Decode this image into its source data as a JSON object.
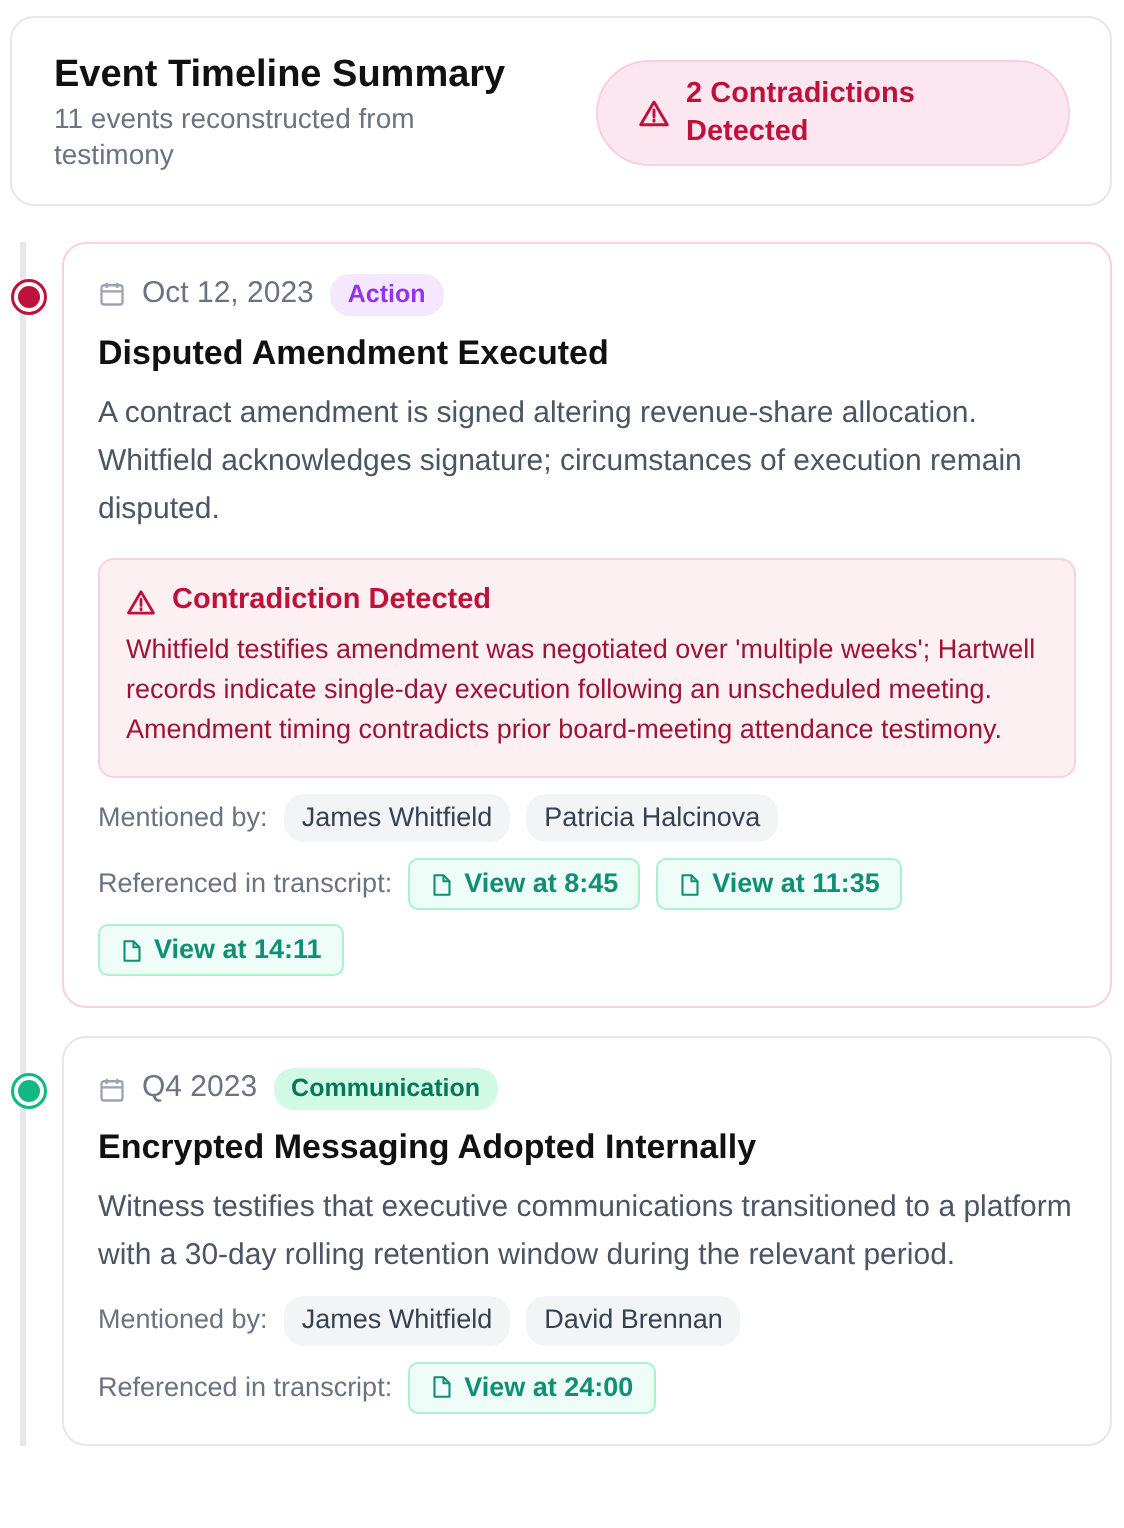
{
  "summary": {
    "title": "Event Timeline Summary",
    "subtitle": "11 events reconstructed from testimony",
    "alert": "2 Contradictions Detected"
  },
  "events": [
    {
      "color": "#be123c",
      "date": "Oct 12, 2023",
      "tag": {
        "kind": "action",
        "label": "Action"
      },
      "title": "Disputed Amendment Executed",
      "description": "A contract amendment is signed altering revenue-share allocation. Whitfield acknowledges signature; circumstances of execution remain disputed.",
      "contradiction": {
        "title": "Contradiction Detected",
        "text": "Whitfield testifies amendment was negotiated over 'multiple weeks'; Hartwell records indicate single-day execution following an unscheduled meeting. Amendment timing contradicts prior board-meeting attendance testimony."
      },
      "mentioned_label": "Mentioned by:",
      "mentioned_by": [
        "James Whitfield",
        "Patricia Halcinova"
      ],
      "transcript_label": "Referenced in transcript:",
      "transcript_links": [
        "View at 8:45",
        "View at 11:35",
        "View at 14:11"
      ]
    },
    {
      "color": "#10b981",
      "date": "Q4 2023",
      "tag": {
        "kind": "communication",
        "label": "Communication"
      },
      "title": "Encrypted Messaging Adopted Internally",
      "description": "Witness testifies that executive communications transitioned to a platform with a 30-day rolling retention window during the relevant period.",
      "mentioned_label": "Mentioned by:",
      "mentioned_by": [
        "James Whitfield",
        "David Brennan"
      ],
      "transcript_label": "Referenced in transcript:",
      "transcript_links": [
        "View at 24:00"
      ]
    }
  ]
}
